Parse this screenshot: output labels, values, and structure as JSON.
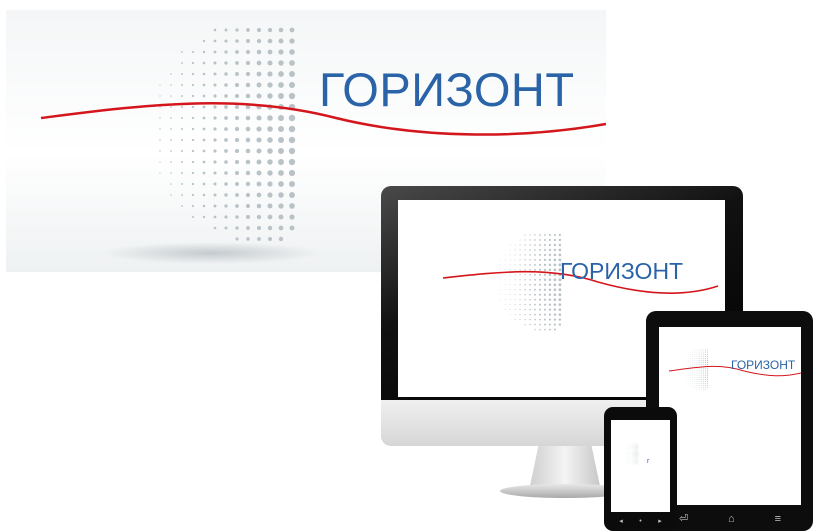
{
  "brand": {
    "name": "ГОРИЗОНТ",
    "phone_text": "г",
    "text_color": "#2a63a8",
    "swoosh_color": "#d4161c",
    "dot_color": "#b9c2c7"
  },
  "devices": {
    "monitor": {
      "icon": "monitor-icon"
    },
    "tablet": {
      "nav_icons": [
        "back-icon",
        "home-icon",
        "menu-icon"
      ],
      "nav_glyphs": [
        "⏎",
        "⌂",
        "≡"
      ]
    },
    "phone": {
      "nav_glyphs": [
        "◂",
        "•",
        "▸"
      ]
    }
  }
}
